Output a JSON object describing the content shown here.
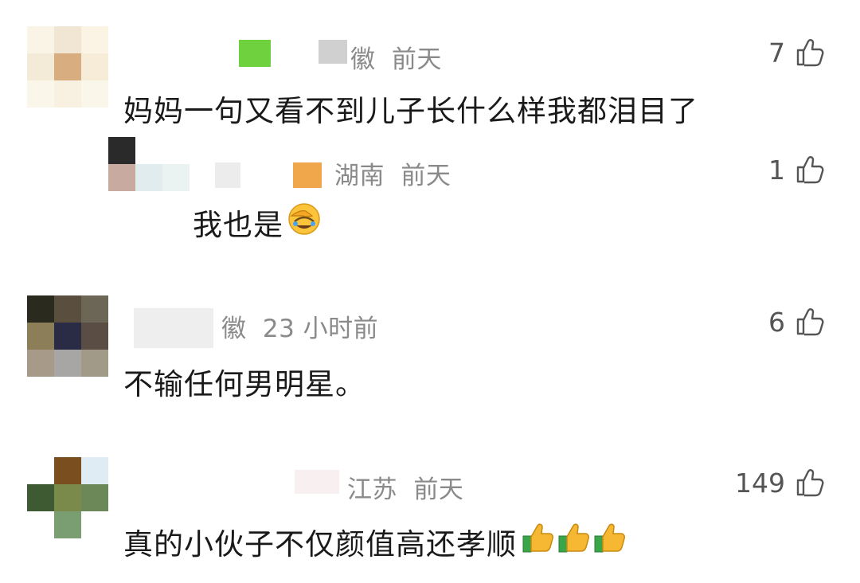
{
  "comments": [
    {
      "region_suffix": "徽",
      "time": "前天",
      "likes": "7",
      "text": "妈妈一句又看不到儿子长什么样我都泪目了",
      "avatar_colors": [
        "#faf4e6",
        "#f1e6d4",
        "#fbf3e4",
        "#f3ead8",
        "#d8ad7f",
        "#f6ecd8",
        "#fbf6ea",
        "#f8f0e0",
        "#fbf6ea"
      ],
      "nick_colors": [
        "#6fd13e",
        "#d0d0d0"
      ]
    },
    {
      "region_suffix": "湖南",
      "time": "前天",
      "likes": "1",
      "text": "我也是",
      "emoji": "facepalm",
      "avatar_colors": [
        "#2a2a2a",
        "#ffffff",
        "#ffffff",
        "#c8aaa0",
        "#e0ecee",
        "#eaf2f2"
      ],
      "nick_colors": [
        "#ececec",
        "#f0a64a"
      ]
    },
    {
      "region_suffix": "徽",
      "time": "23 小时前",
      "likes": "6",
      "text": "不输任何男明星。",
      "avatar_colors": [
        "#2a2a1e",
        "#5a4e3e",
        "#6b6656",
        "#8c7e58",
        "#2a2c46",
        "#5a4e44",
        "#a89a88",
        "#a8a6a4",
        "#a19a88"
      ],
      "nick_colors": [
        "#eeeeee",
        "#f4f4f4"
      ]
    },
    {
      "region_suffix": "江苏",
      "time": "前天",
      "likes": "149",
      "text": "真的小伙子不仅颜值高还孝顺",
      "emoji": "thumbs",
      "avatar_colors": [
        "#ffffff",
        "#7a4e1e",
        "#e0ecf4",
        "#3e5a32",
        "#7a8a4a",
        "#6c8858",
        "#ffffff",
        "#7a9e72",
        "#ffffff"
      ],
      "nick_colors": [
        "#f8f0f0",
        "#ffffff"
      ]
    }
  ],
  "colors": {
    "meta": "#8a8a8a",
    "text": "#1a1a1a"
  }
}
